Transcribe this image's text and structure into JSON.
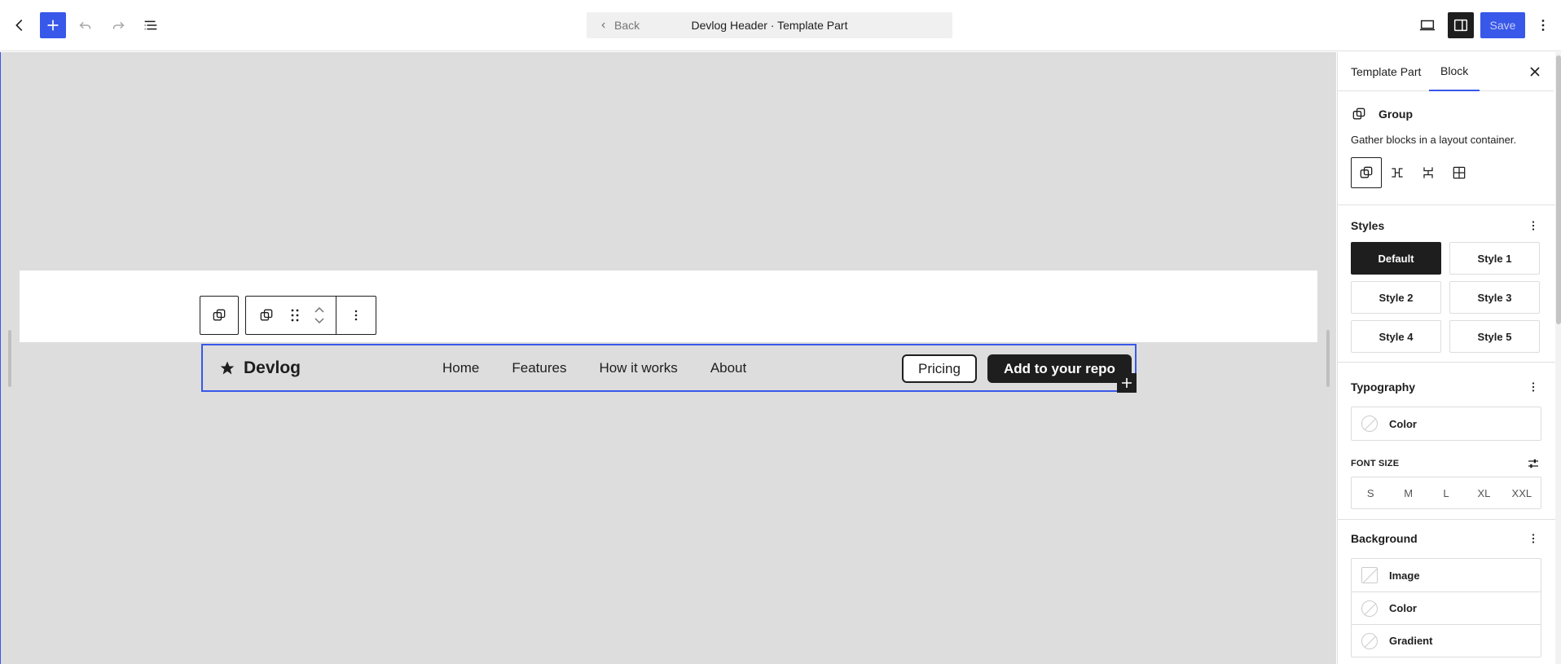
{
  "topbar": {
    "back_icon": "chevron-left-icon",
    "add_icon": "plus-icon",
    "undo_icon": "undo-icon",
    "redo_icon": "redo-icon",
    "list_view_icon": "list-view-icon",
    "document": {
      "back_label": "Back",
      "title": "Devlog Header · Template Part"
    },
    "view_icon": "desktop-icon",
    "settings_icon": "sidebar-icon",
    "save_label": "Save",
    "options_icon": "more-vertical-icon",
    "accent": "#3858e9"
  },
  "canvas": {
    "background": "#dddddd",
    "block_toolbar": {
      "parent_icon": "group-icon",
      "block_icon": "group-icon",
      "drag_icon": "drag-handle-icon",
      "move_up_icon": "chevron-up-icon",
      "move_down_icon": "chevron-down-icon",
      "options_icon": "more-vertical-icon"
    },
    "header": {
      "logo_icon": "star-icon",
      "site_title": "Devlog",
      "nav": [
        "Home",
        "Features",
        "How it works",
        "About"
      ],
      "button_outline": "Pricing",
      "button_primary": "Add to your repo"
    },
    "inserter_icon": "plus-icon"
  },
  "sidebar": {
    "tabs": [
      {
        "label": "Template Part",
        "active": false
      },
      {
        "label": "Block",
        "active": true
      }
    ],
    "close_icon": "close-icon",
    "block_card": {
      "icon": "group-icon",
      "title": "Group",
      "description": "Gather blocks in a layout container."
    },
    "variations": [
      {
        "icon": "group-icon",
        "active": true
      },
      {
        "icon": "row-icon",
        "active": false
      },
      {
        "icon": "stack-icon",
        "active": false
      },
      {
        "icon": "grid-icon",
        "active": false
      }
    ],
    "styles": {
      "title": "Styles",
      "options": [
        "Default",
        "Style 1",
        "Style 2",
        "Style 3",
        "Style 4",
        "Style 5"
      ],
      "active": "Default"
    },
    "typography": {
      "title": "Typography",
      "color_label": "Color",
      "font_size_label": "FONT SIZE",
      "font_size_options": [
        "S",
        "M",
        "L",
        "XL",
        "XXL"
      ],
      "settings_icon": "settings-sliders-icon"
    },
    "background": {
      "title": "Background",
      "items": [
        "Image",
        "Color",
        "Gradient"
      ]
    }
  }
}
